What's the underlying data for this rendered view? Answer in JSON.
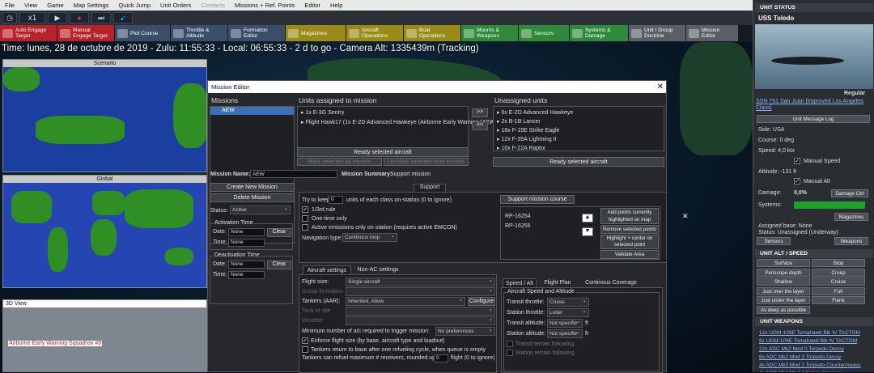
{
  "menu": [
    "File",
    "View",
    "Game",
    "Map Settings",
    "Quick Jump",
    "Unit Orders",
    "Contacts",
    "Missions + Ref. Points",
    "Editor",
    "Help"
  ],
  "menu_disabled": [
    "Contacts"
  ],
  "speed": {
    "icon": "clock-icon",
    "multiplier": "x1"
  },
  "toolbar2": [
    {
      "label": "Auto Engage\nTarget",
      "icon": "auto-engage-icon",
      "color": "#b8232b"
    },
    {
      "label": "Manual\nEngage Target",
      "icon": "manual-engage-icon",
      "color": "#b8232b"
    },
    {
      "label": "Plot Course",
      "icon": "plot-course-icon",
      "color": "#3a4e6a"
    },
    {
      "label": "Throttle &\nAltitude",
      "icon": "throttle-icon",
      "color": "#3a4e6a"
    },
    {
      "label": "Formation\nEditor",
      "icon": "formation-icon",
      "color": "#3a4e6a"
    },
    {
      "label": "Magazines",
      "icon": "magazines-icon",
      "color": "#9a8a18"
    },
    {
      "label": "Aircraft\nOperations",
      "icon": "aircraft-icon",
      "color": "#9a8a18"
    },
    {
      "label": "Boat\nOperations",
      "icon": "boat-icon",
      "color": "#9a8a18"
    },
    {
      "label": "Mounts &\nWeapons",
      "icon": "mounts-icon",
      "color": "#2e8a3a"
    },
    {
      "label": "Sensors",
      "icon": "sensors-icon",
      "color": "#2e8a3a"
    },
    {
      "label": "Systems &\nDamage",
      "icon": "systems-icon",
      "color": "#2e8a3a"
    },
    {
      "label": "Unit / Group\nDoctrine",
      "icon": "doctrine-icon",
      "color": "#5a5e66"
    },
    {
      "label": "Mission\nEditor",
      "icon": "mission-icon",
      "color": "#5a5e66"
    }
  ],
  "time_line": "Time: lunes, 28 de octubre de 2019 - Zulu: 11:55:33 - Local: 06:55:33 - 2 d to go -  Camera Alt: 1335439m (Tracking)",
  "panels": {
    "scenario": "Scenario",
    "global": "Global",
    "view3d": "3D View",
    "squadron_label": "Airborne Early Warning Squadron #9"
  },
  "dialog": {
    "title": "Mission Editor",
    "missions_header": "Missions",
    "missions": [
      "AEW"
    ],
    "assigned_header": "Units assigned to mission",
    "assigned": [
      "1x E-3G Sentry",
      "Flight Hawk17 (1x E-2D Advanced Hawkeye (Airborne Early Warning (AEW))"
    ],
    "move_right": ">>",
    "move_left": "<<",
    "unassigned_header": "Unassigned units",
    "unassigned": [
      "6x E-2D Advanced Hawkeye",
      "2x B-1B Lancer",
      "18x F-15E Strike Eagle",
      "12x F-35A Lightning II",
      "10x F-22A Raptor"
    ],
    "ready_aircraft": "Ready selected aircraft",
    "mark_escorts": "Mark selected as escorts",
    "unmark_escorts": "Un-Mark selected from escorts",
    "ready_aircraft2": "Ready selected aircraft",
    "mission_name_label": "Mission Name:",
    "mission_name": "AEW",
    "mission_summary_label": "Mission Summary:",
    "mission_summary": "Support mission",
    "create_btn": "Create New Mission",
    "delete_btn": "Delete Mission",
    "status_label": "Status:",
    "status": "Active",
    "activation_title": "Activation Time",
    "deactivation_title": "Deactivation Time",
    "date_label": "Date:",
    "time_label": "Time:",
    "none": "None",
    "clear": "Clear",
    "support_tab": "Support",
    "try_keep_pre": "Try to keep",
    "try_keep_val": "0",
    "try_keep_post": "units of each class on-station (0 to ignore)",
    "third_rule": "1/3rd rule",
    "one_time": "One-time only",
    "active_emissions": "Active emissions only on-station (requires active EMCON)",
    "nav_type_label": "Navigation type:",
    "nav_type": "Continous loop",
    "course_header": "Support mission course",
    "course_points": [
      "RP-16254",
      "RP-16255"
    ],
    "add_points": "Add points currently highlighted on map",
    "remove_points": "Remove selected points",
    "highlight_center": "Highlight + center on selected point",
    "validate_area": "Validate Area",
    "tab_aircraft": "Aircraft settings",
    "tab_nonac": "Non-AC settings",
    "flight_size_label": "Flight size:",
    "flight_size": "Single aircraft",
    "qty_label": "Group formation",
    "qty": "",
    "tankers_label": "Tankers (AAR):",
    "tankers": "Inherited, Allow",
    "configure": "Configure",
    "tank_stay": "Tank at site",
    "weather": "Weather",
    "min_ac_label": "Minimum number of a/c required to trigger mission:",
    "min_ac": "No preferences",
    "enforce_flight": "Enforce flight size (by base, aircraft type and loadout)",
    "tankers_return": "Tankers return to base after one refueling cycle, when queue is empty",
    "tankers_refuel_pre": "Tankers can refuel maximum # receivers, rounded up to",
    "tankers_refuel_val": "0",
    "tankers_refuel_post": "flight (0 to ignore)",
    "tab_speed": "Speed / Alt",
    "tab_flight": "Flight Plan",
    "tab_coverage": "Continous Coverage",
    "speed_group": "Aircraft Speed and Altitude",
    "transit_throttle_label": "Transit throttle:",
    "transit_throttle": "Cruise",
    "station_throttle_label": "Station throttle:",
    "station_throttle": "Loiter",
    "transit_alt_label": "Transit altitude:",
    "transit_alt": "Not specifie",
    "ft": "ft",
    "station_alt_label": "Station altitude:",
    "station_alt": "Not specifie",
    "terrain_transit": "Transit terrain following",
    "terrain_station": "Station terrain following",
    "close": "✕"
  },
  "right": {
    "unit_status": "UNIT STATUS",
    "unit_name": "USS Toledo",
    "proficiency": "Regular",
    "class_link": "SSN 751 San Juan [Improved Los Angeles Class]",
    "msg_log": "Unit Message Log",
    "side": "Side: USA",
    "course": "Course: 0 deg",
    "speed": "Speed: 4,0 kts",
    "manual_speed": "Manual Speed",
    "altitude": "Altitude: -131 ft",
    "manual_alt": "Manual Alt",
    "damage_label": "Damage:",
    "damage_val": "0,0%",
    "damage_ctrl": "Damage Ctrl",
    "systems": "Systems:",
    "magazines": "Magazines",
    "assigned_base": "Assigned base: None",
    "status": "Status: Unassigned (Underway)",
    "sensors": "Sensors",
    "weapons": "Weapons",
    "alt_speed": "UNIT ALT / SPEED",
    "alt_buttons": [
      [
        "Surface",
        "Stop"
      ],
      [
        "Periscope depth",
        "Creep"
      ],
      [
        "Shallow",
        "Cruise"
      ],
      [
        "Just over the layer",
        "Full"
      ],
      [
        "Just under the layer",
        "Flank"
      ]
    ],
    "as_deep": "As deep as possible",
    "unit_weapons": "UNIT WEAPONS",
    "weapons_list": [
      "12x UGM-109E Tomahawk Blk IV TACTOM",
      "8x UGM-109E Tomahawk Blk IV TACTOM",
      "22x ADC Mk2 Mod 0 Torpedo Decoy",
      "6x ADC Mk2 Mod 3 Torpedo Decoy",
      "4x ADC Mk3 Mod 1 Torpedo Countermeasu",
      "4x ADC Mk4 Mod 1 Sonar Jammer"
    ]
  },
  "colors": {
    "accent": "#2f8f24",
    "health": "#1ea12a",
    "link": "#8fb6ff"
  }
}
